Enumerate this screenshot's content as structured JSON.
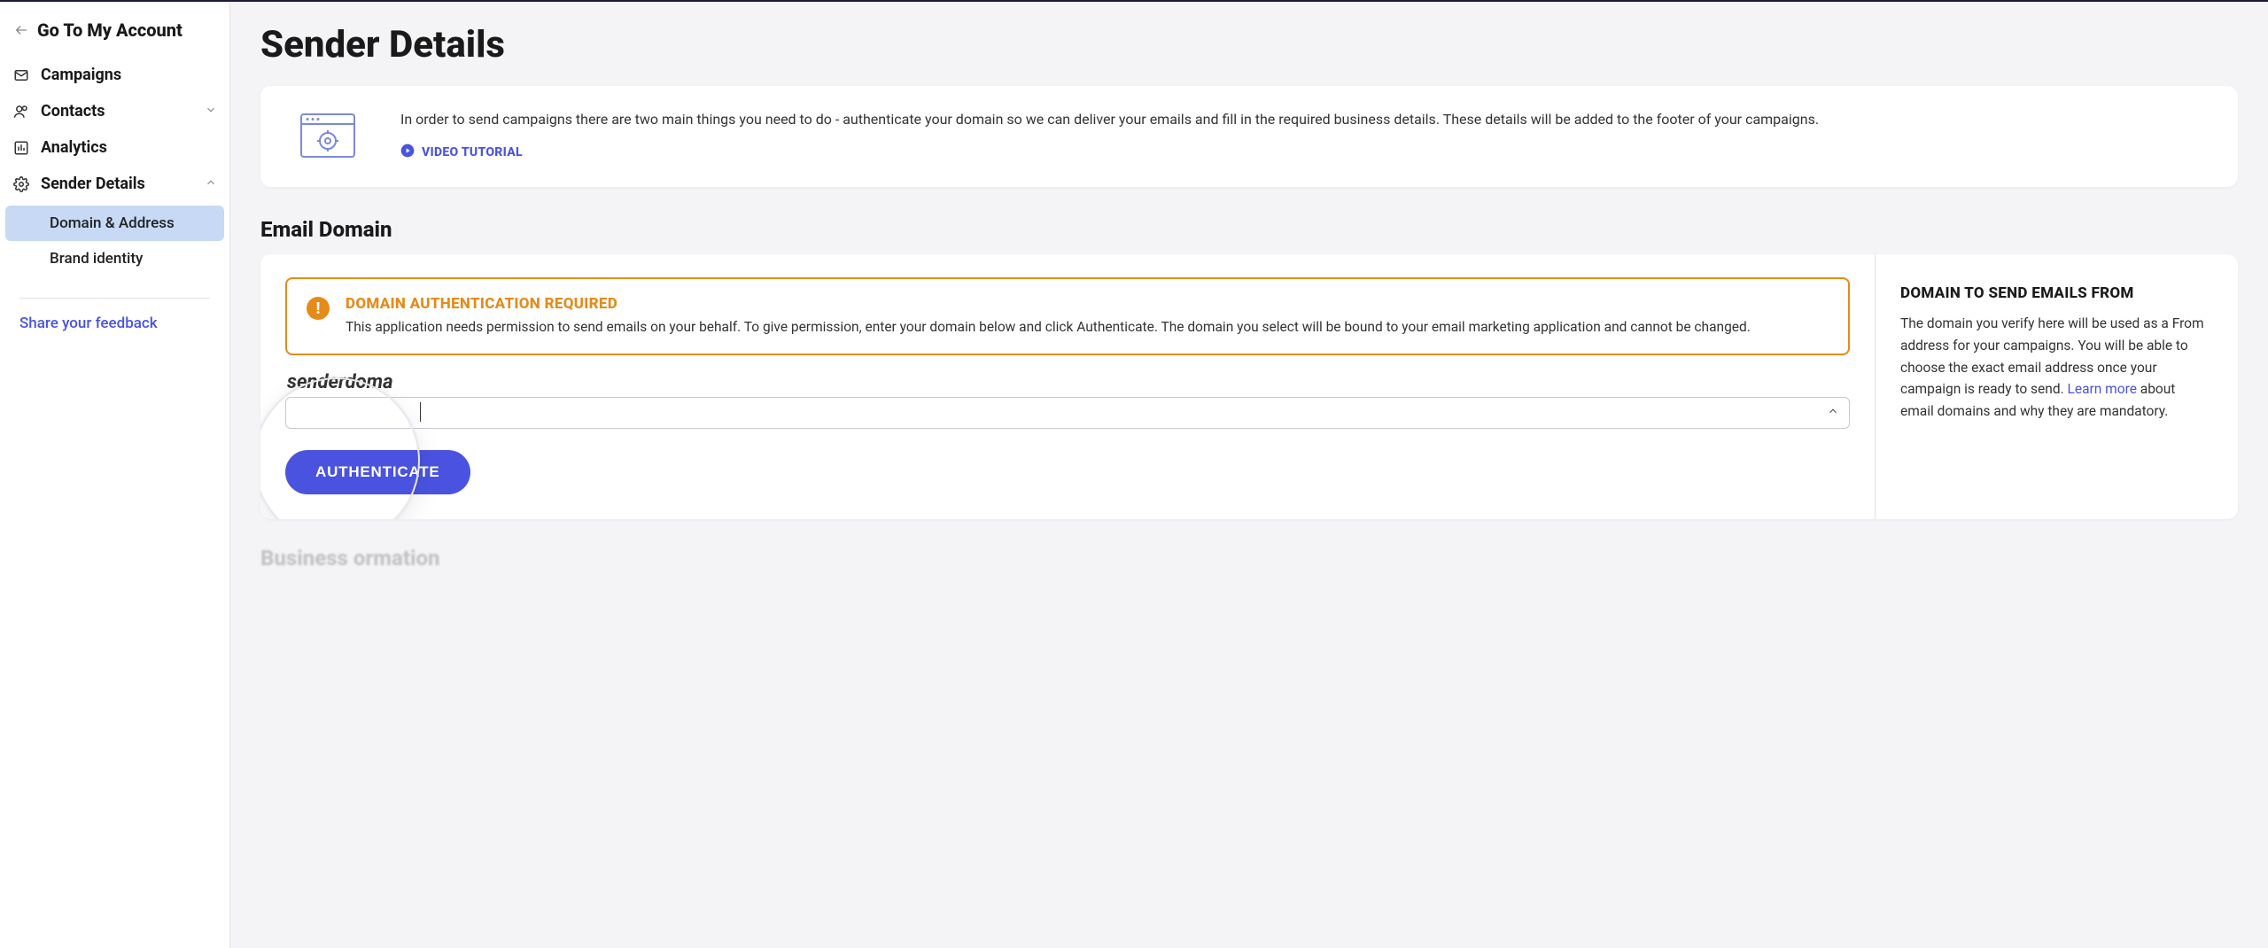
{
  "sidebar": {
    "back_label": "Go To My Account",
    "items": [
      {
        "label": "Campaigns",
        "icon": "mail-icon",
        "expandable": false
      },
      {
        "label": "Contacts",
        "icon": "people-icon",
        "expandable": true,
        "expanded": false
      },
      {
        "label": "Analytics",
        "icon": "chart-icon",
        "expandable": false
      },
      {
        "label": "Sender Details",
        "icon": "gear-icon",
        "expandable": true,
        "expanded": true,
        "children": [
          {
            "label": "Domain & Address",
            "active": true
          },
          {
            "label": "Brand identity",
            "active": false
          }
        ]
      }
    ],
    "feedback_label": "Share your feedback"
  },
  "page": {
    "title": "Sender Details",
    "intro_text": "In order to send campaigns there are two main things you need to do - authenticate your domain so we can deliver your emails and fill in the required business details. These details will be added to the footer of your campaigns.",
    "video_link_label": "VIDEO TUTORIAL",
    "email_domain": {
      "section_title": "Email Domain",
      "warning_title": "DOMAIN AUTHENTICATION REQUIRED",
      "warning_body": "This application needs permission to send emails on your behalf. To give permission, enter your domain below and click Authenticate. The domain you select will be bound to your email marketing application and cannot be changed.",
      "field_label": "senderdoma",
      "input_value": "",
      "auth_button_label": "AUTHENTICATE",
      "right_title": "DOMAIN TO SEND EMAILS FROM",
      "right_body_before_link": "The domain you verify here will be used as a From address for your campaigns. You will be able to choose the exact email address once your campaign is ready to send. ",
      "right_link_label": "Learn more",
      "right_body_after_link": " about email domains and why they are mandatory."
    },
    "business_section_title": "Business  ormation"
  }
}
